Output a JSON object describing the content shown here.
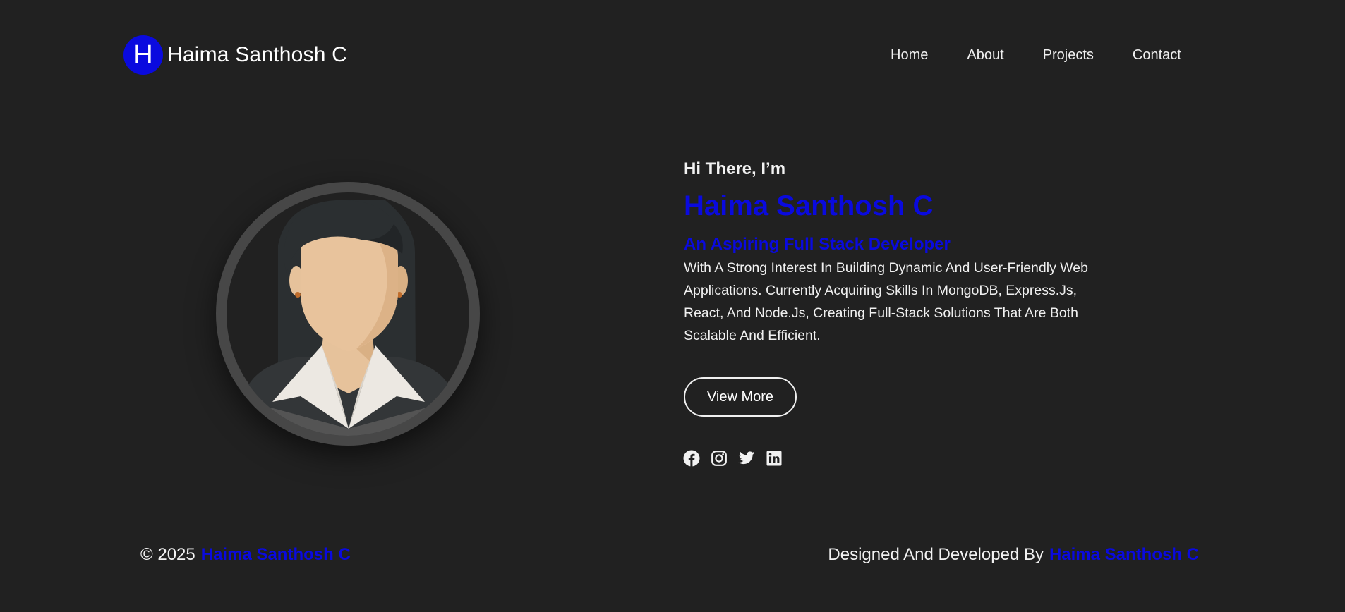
{
  "brand": {
    "logo_letter": "H",
    "name": "Haima Santhosh C"
  },
  "nav": {
    "items": [
      "Home",
      "About",
      "Projects",
      "Contact"
    ]
  },
  "hero": {
    "greeting": "Hi There, I’m",
    "name": "Haima Santhosh C",
    "role": "An Aspiring Full Stack Developer",
    "bio": "With A Strong Interest In Building Dynamic And User-Friendly Web Applications. Currently Acquiring Skills In MongoDB, Express.Js, React, And Node.Js, Creating Full-Stack Solutions That Are Both Scalable And Efficient.",
    "button_label": "View More"
  },
  "socials": [
    {
      "icon": "facebook-icon"
    },
    {
      "icon": "instagram-icon"
    },
    {
      "icon": "twitter-icon"
    },
    {
      "icon": "linkedin-icon"
    }
  ],
  "footer": {
    "copyright_prefix": "© 2025",
    "copyright_name": "Haima Santhosh C",
    "credit_prefix": "Designed And Developed By",
    "credit_name": "Haima Santhosh C"
  },
  "colors": {
    "background": "#212121",
    "accent": "#0a0adf",
    "text": "#f2f2f2"
  },
  "avatar": {
    "icon": "woman-avatar-icon"
  }
}
